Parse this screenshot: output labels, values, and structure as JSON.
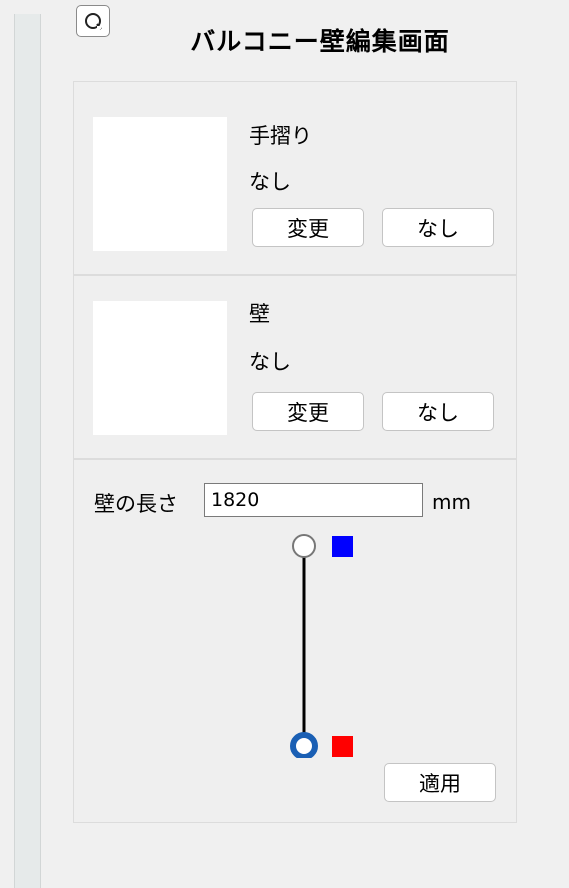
{
  "header": {
    "title": "バルコニー壁編集画面",
    "refresh_icon": "refresh-icon"
  },
  "railing": {
    "label": "手摺り",
    "value": "なし",
    "change_label": "変更",
    "none_label": "なし"
  },
  "wall": {
    "label": "壁",
    "value": "なし",
    "change_label": "変更",
    "none_label": "なし"
  },
  "length": {
    "label": "壁の長さ",
    "value": "1820",
    "unit": "mm"
  },
  "diagram": {
    "start_color": "#0000ff",
    "end_color": "#ff0000",
    "selected_handle_color": "#1a5fb4"
  },
  "apply_label": "適用"
}
